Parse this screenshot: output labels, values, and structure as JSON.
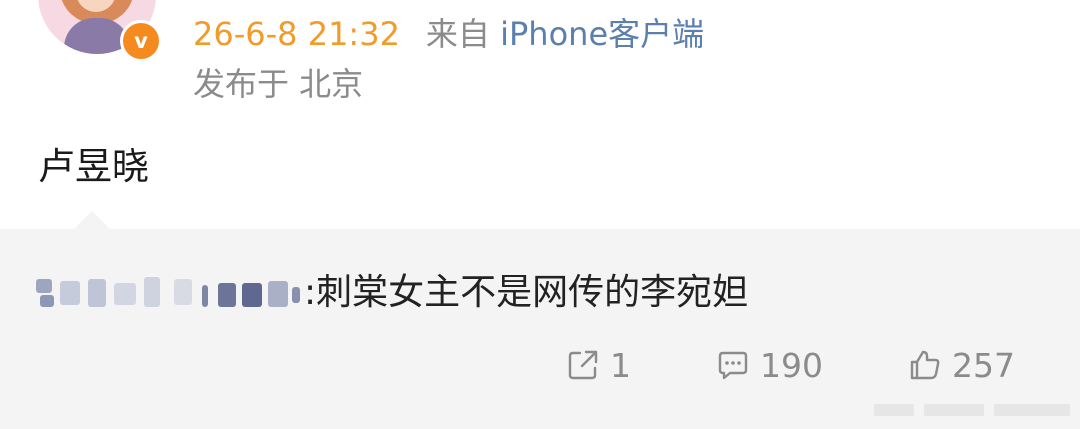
{
  "header": {
    "avatar": "user-avatar",
    "badge_label": "v",
    "badge_color": "#f58a1f",
    "time": "26-6-8 21:32",
    "from_label": "来自",
    "client": "iPhone客户端",
    "location": "发布于 北京"
  },
  "post": {
    "text": "卢昱晓"
  },
  "repost": {
    "author_blurred": true,
    "text": ":刺棠女主不是网传的李宛妲"
  },
  "actions": {
    "repost_count": "1",
    "comment_count": "190",
    "like_count": "257"
  },
  "colors": {
    "time": "#f09b2a",
    "client": "#5b7faf",
    "secondary_text": "#8b8b8b",
    "repost_bg": "#f4f4f4",
    "body_text": "#1a1a1a"
  }
}
